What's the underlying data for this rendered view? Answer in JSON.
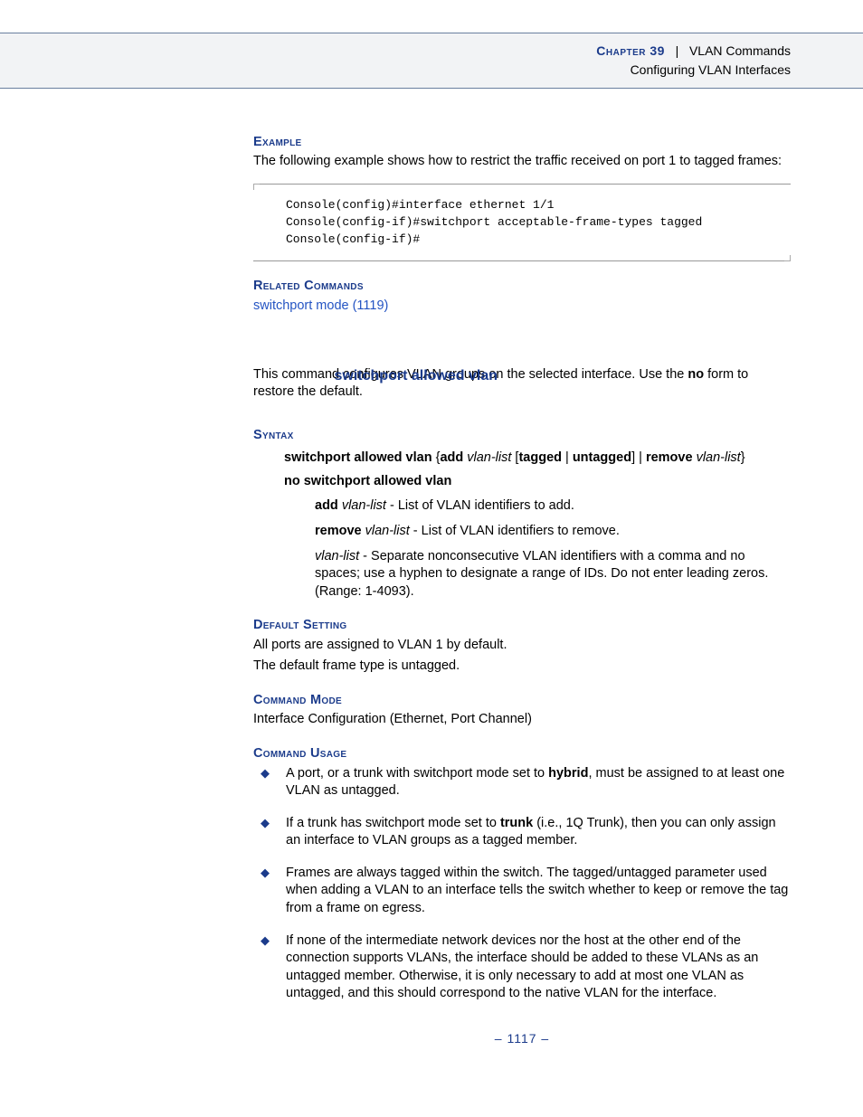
{
  "header": {
    "chapter_label": "Chapter 39",
    "chapter_title": "VLAN Commands",
    "subtitle": "Configuring VLAN Interfaces"
  },
  "section1": {
    "example_label": "Example",
    "example_text": "The following example shows how to restrict the traffic received on port 1 to tagged frames:",
    "code": "Console(config)#interface ethernet 1/1\nConsole(config-if)#switchport acceptable-frame-types tagged\nConsole(config-if)#",
    "related_label": "Related Commands",
    "related_link": "switchport mode (1119)"
  },
  "section2": {
    "sidehead": "switchport allowed vlan",
    "desc_prefix": "This command configures VLAN groups on the selected interface. Use the ",
    "desc_bold": "no",
    "desc_suffix": " form to restore the default.",
    "syntax_label": "Syntax",
    "syntax_line1": {
      "cmd": "switchport allowed vlan",
      "brace_open": " {",
      "add": "add",
      "sp1": " ",
      "vlanlist1": "vlan-list",
      "bracket_open": " [",
      "tagged": "tagged",
      "pipe": " | ",
      "untagged": "untagged",
      "bracket_close": "] | ",
      "remove": "remove",
      "sp2": " ",
      "vlanlist2": "vlan-list",
      "brace_close": "}"
    },
    "syntax_line2": "no switchport allowed vlan",
    "param_add": {
      "name": "add",
      "arg": "vlan-list",
      "desc": " - List of VLAN identifiers to add."
    },
    "param_remove": {
      "name": "remove",
      "arg": "vlan-list",
      "desc": " - List of VLAN identifiers to remove."
    },
    "param_vlanlist": {
      "arg": "vlan-list",
      "desc": " - Separate nonconsecutive VLAN identifiers with a comma and no spaces; use a hyphen to designate a range of IDs. Do not enter leading zeros. (Range: 1-4093)."
    },
    "default_label": "Default Setting",
    "default_text1": "All ports are assigned to VLAN 1 by default.",
    "default_text2": "The default frame type is untagged.",
    "mode_label": "Command Mode",
    "mode_text": "Interface Configuration (Ethernet, Port Channel)",
    "usage_label": "Command Usage",
    "usage": {
      "li1_a": "A port, or a trunk with switchport mode set to ",
      "li1_b": "hybrid",
      "li1_c": ", must be assigned to at least one VLAN as untagged.",
      "li2_a": "If a trunk has switchport mode set to ",
      "li2_b": "trunk",
      "li2_c": " (i.e., 1Q Trunk), then you can only assign an interface to VLAN groups as a tagged member.",
      "li3": "Frames are always tagged within the switch. The tagged/untagged parameter used when adding a VLAN to an interface tells the switch whether to keep or remove the tag from a frame on egress.",
      "li4": "If none of the intermediate network devices nor the host at the other end of the connection supports VLANs, the interface should be added to these VLANs as an untagged member. Otherwise, it is only necessary to add at most one VLAN as untagged, and this should correspond to the native VLAN for the interface."
    }
  },
  "footer": {
    "page": "–  1117  –"
  }
}
